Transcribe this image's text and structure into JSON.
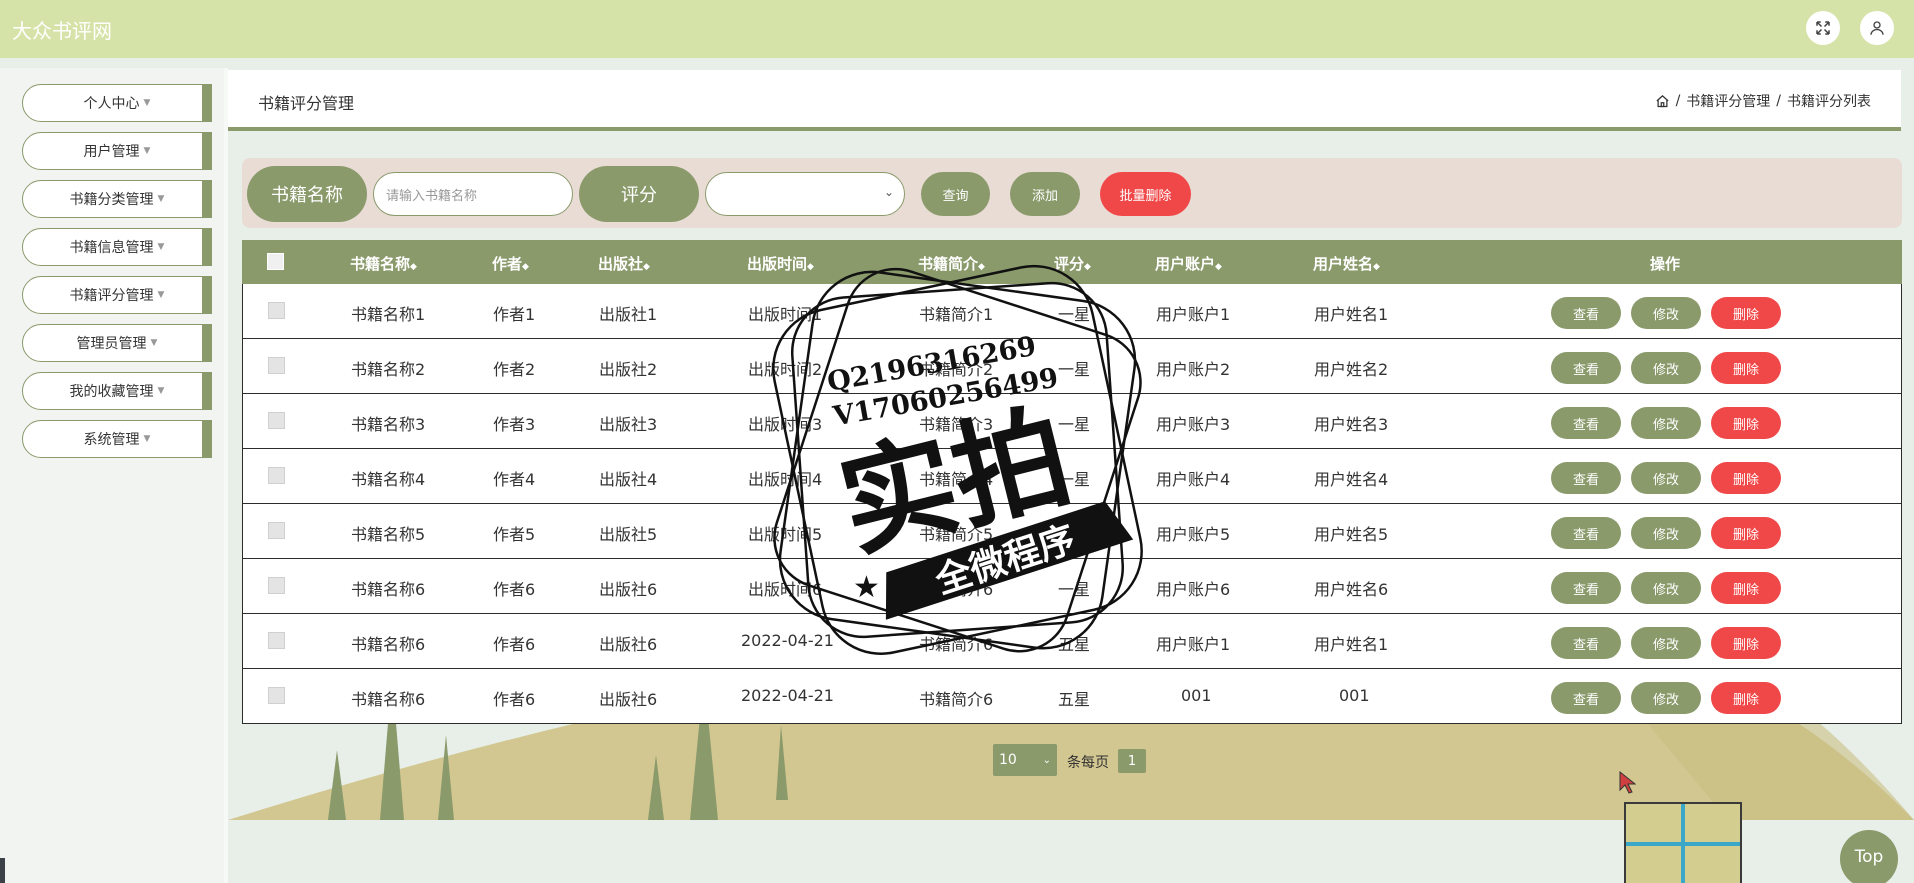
{
  "app": {
    "title": "大众书评网"
  },
  "colors": {
    "accent": "#8a9a6b",
    "danger": "#f05a5a",
    "header_bg": "#d6e3a8"
  },
  "header": {
    "icons": [
      "fullscreen-icon",
      "user-icon"
    ]
  },
  "sidebar": {
    "items": [
      {
        "label": "个人中心"
      },
      {
        "label": "用户管理"
      },
      {
        "label": "书籍分类管理"
      },
      {
        "label": "书籍信息管理"
      },
      {
        "label": "书籍评分管理"
      },
      {
        "label": "管理员管理"
      },
      {
        "label": "我的收藏管理"
      },
      {
        "label": "系统管理"
      }
    ]
  },
  "page": {
    "title": "书籍评分管理",
    "breadcrumb": {
      "level1": "书籍评分管理",
      "level2": "书籍评分列表",
      "separator": "/"
    }
  },
  "search": {
    "name_label": "书籍名称",
    "name_placeholder": "请输入书籍名称",
    "name_value": "",
    "score_label": "评分",
    "score_selected": "",
    "query_button": "查询",
    "add_button": "添加",
    "batch_delete_button": "批量删除"
  },
  "table": {
    "columns": [
      "书籍名称",
      "作者",
      "出版社",
      "出版时间",
      "书籍简介",
      "评分",
      "用户账户",
      "用户姓名",
      "操作"
    ],
    "actions": {
      "view": "查看",
      "edit": "修改",
      "delete": "删除"
    },
    "rows": [
      {
        "name": "书籍名称1",
        "author": "作者1",
        "publisher": "出版社1",
        "time": "出版时间1",
        "intro": "书籍简介1",
        "score": "一星",
        "account": "用户账户1",
        "username": "用户姓名1"
      },
      {
        "name": "书籍名称2",
        "author": "作者2",
        "publisher": "出版社2",
        "time": "出版时间2",
        "intro": "书籍简介2",
        "score": "一星",
        "account": "用户账户2",
        "username": "用户姓名2"
      },
      {
        "name": "书籍名称3",
        "author": "作者3",
        "publisher": "出版社3",
        "time": "出版时间3",
        "intro": "书籍简介3",
        "score": "一星",
        "account": "用户账户3",
        "username": "用户姓名3"
      },
      {
        "name": "书籍名称4",
        "author": "作者4",
        "publisher": "出版社4",
        "time": "出版时间4",
        "intro": "书籍简介4",
        "score": "一星",
        "account": "用户账户4",
        "username": "用户姓名4"
      },
      {
        "name": "书籍名称5",
        "author": "作者5",
        "publisher": "出版社5",
        "time": "出版时间5",
        "intro": "书籍简介5",
        "score": "一星",
        "account": "用户账户5",
        "username": "用户姓名5"
      },
      {
        "name": "书籍名称6",
        "author": "作者6",
        "publisher": "出版社6",
        "time": "出版时间6",
        "intro": "书籍简介6",
        "score": "一星",
        "account": "用户账户6",
        "username": "用户姓名6"
      },
      {
        "name": "书籍名称6",
        "author": "作者6",
        "publisher": "出版社6",
        "time": "2022-04-21",
        "intro": "书籍简介6",
        "score": "五星",
        "account": "用户账户1",
        "username": "用户姓名1"
      },
      {
        "name": "书籍名称6",
        "author": "作者6",
        "publisher": "出版社6",
        "time": "2022-04-21",
        "intro": "书籍简介6",
        "score": "五星",
        "account": "001",
        "username": "001"
      }
    ]
  },
  "pagination": {
    "page_size": "10",
    "per_page_label": "条每页",
    "current_page": "1"
  },
  "watermark": {
    "line1": "Q2196316269",
    "line2": "V17060256499",
    "main": "实拍",
    "banner": "全微程序"
  },
  "back_to_top": "Top"
}
